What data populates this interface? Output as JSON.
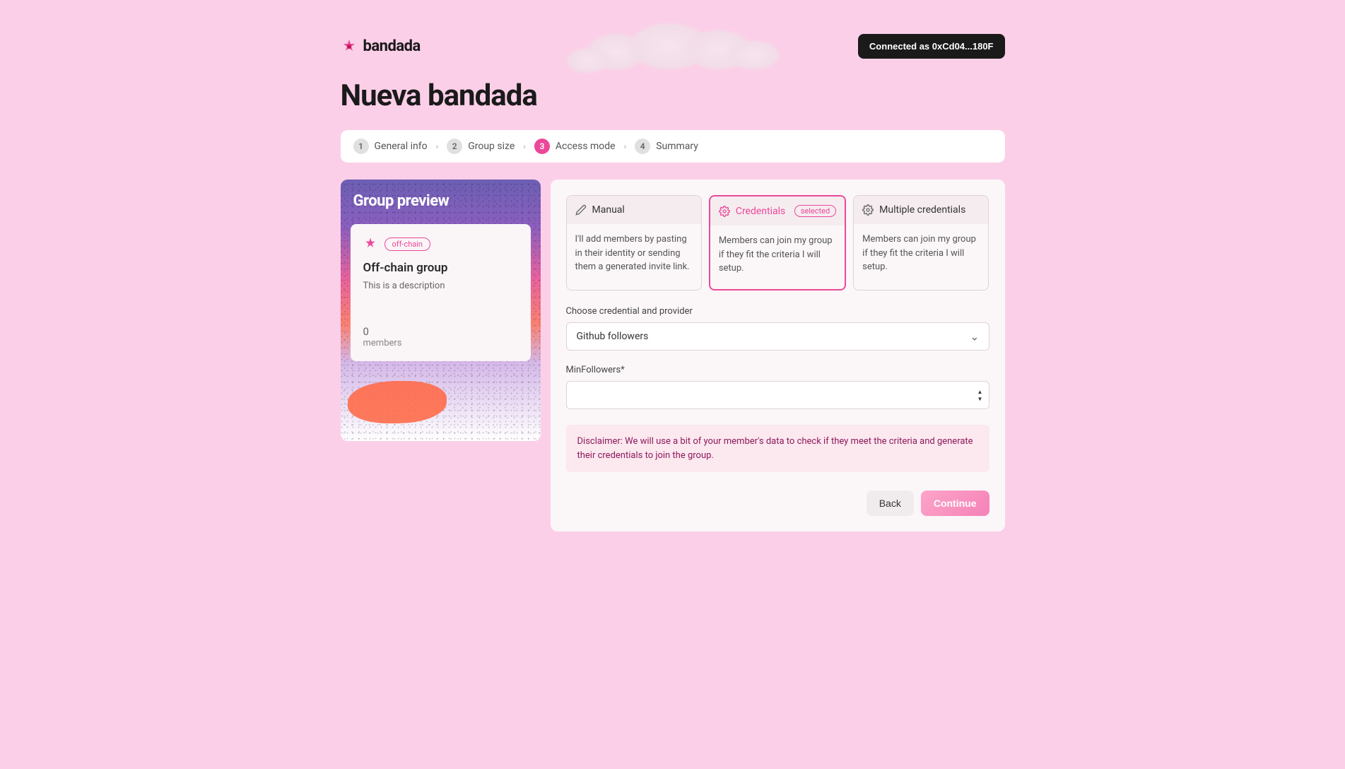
{
  "brand": "bandada",
  "header": {
    "connected_label": "Connected as 0xCd04...180F"
  },
  "page_title": "Nueva bandada",
  "steps": [
    {
      "num": "1",
      "label": "General info"
    },
    {
      "num": "2",
      "label": "Group size"
    },
    {
      "num": "3",
      "label": "Access mode"
    },
    {
      "num": "4",
      "label": "Summary"
    }
  ],
  "active_step_index": 2,
  "preview": {
    "title": "Group preview",
    "chain_badge": "off-chain",
    "group_name": "Off-chain group",
    "group_desc": "This is a description",
    "members_count": "0",
    "members_label": "members"
  },
  "access_modes": [
    {
      "key": "manual",
      "label": "Manual",
      "desc": "I'll add members by pasting in their identity or sending them a generated invite link.",
      "icon": "pencil-icon"
    },
    {
      "key": "credentials",
      "label": "Credentials",
      "desc": "Members can join my group if they fit the criteria I will setup.",
      "icon": "gear-icon",
      "selected": true,
      "selected_badge": "selected"
    },
    {
      "key": "multiple",
      "label": "Multiple credentials",
      "desc": "Members can join my group if they fit the criteria I will setup.",
      "icon": "gear-icon"
    }
  ],
  "credential_form": {
    "provider_label": "Choose credential and provider",
    "provider_value": "Github followers",
    "min_followers_label": "MinFollowers*",
    "min_followers_value": ""
  },
  "disclaimer": "Disclaimer: We will use a bit of your member's data to check if they meet the criteria and generate their credentials to join the group.",
  "actions": {
    "back": "Back",
    "continue": "Continue"
  }
}
